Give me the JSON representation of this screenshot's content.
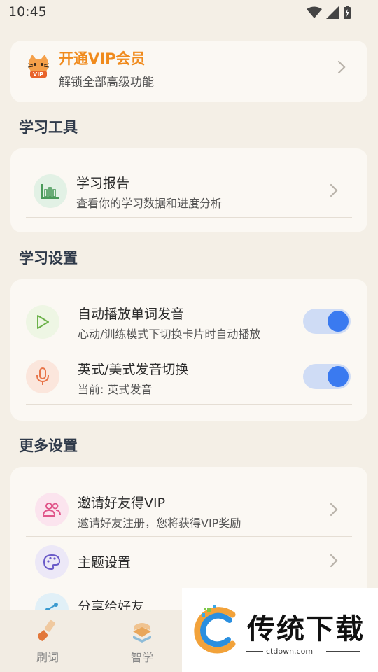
{
  "status_bar": {
    "time": "10:45"
  },
  "vip": {
    "title": "开通VIP会员",
    "subtitle": "解锁全部高级功能",
    "badge": "VIP"
  },
  "sections": {
    "tools": "学习工具",
    "settings": "学习设置",
    "more": "更多设置"
  },
  "tools": {
    "report": {
      "title": "学习报告",
      "subtitle": "查看你的学习数据和进度分析"
    }
  },
  "settings": {
    "autoplay": {
      "title": "自动播放单词发音",
      "subtitle": "心动/训练模式下切换卡片时自动播放",
      "enabled": true
    },
    "accent": {
      "title": "英式/美式发音切换",
      "subtitle": "当前: 英式发音",
      "enabled": true
    }
  },
  "more": {
    "invite": {
      "title": "邀请好友得VIP",
      "subtitle": "邀请好友注册，您将获得VIP奖励"
    },
    "theme": {
      "title": "主题设置"
    },
    "share": {
      "title": "分享给好友"
    }
  },
  "nav": {
    "items": [
      {
        "label": "刷词"
      },
      {
        "label": "智学"
      }
    ]
  },
  "watermark": {
    "brand": "传统下载",
    "url": "ctdown.com"
  },
  "colors": {
    "accent": "#3a7af0",
    "vip_orange": "#f08a1c",
    "background": "#f4efe6"
  }
}
